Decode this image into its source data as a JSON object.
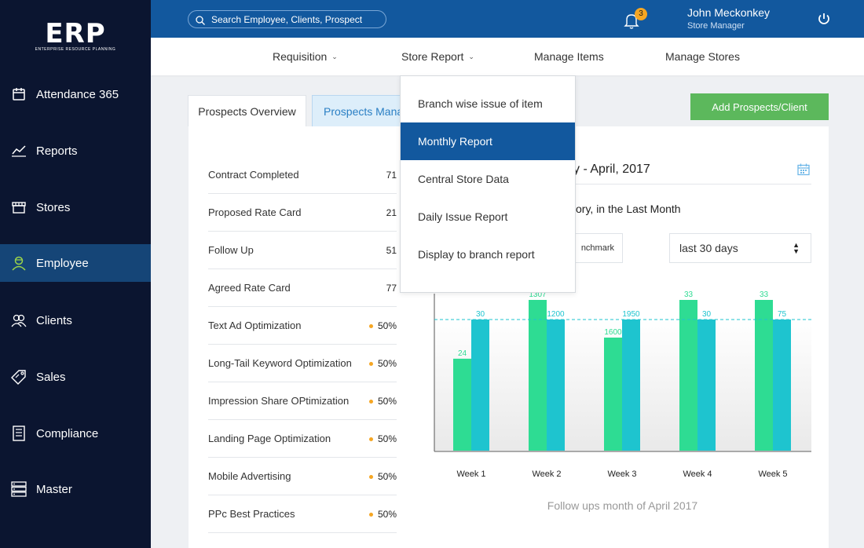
{
  "app": {
    "logo": "ERP",
    "logo_sub": "ENTERPRISE RESOURCE PLANNING"
  },
  "sidebar": {
    "items": [
      {
        "label": "Attendance 365",
        "icon": "calendar-icon"
      },
      {
        "label": "Reports",
        "icon": "trend-icon"
      },
      {
        "label": "Stores",
        "icon": "store-icon"
      },
      {
        "label": "Employee",
        "icon": "user-icon",
        "active": true
      },
      {
        "label": "Clients",
        "icon": "clients-icon"
      },
      {
        "label": "Sales",
        "icon": "tag-icon"
      },
      {
        "label": "Compliance",
        "icon": "document-icon"
      },
      {
        "label": "Master",
        "icon": "server-icon"
      }
    ]
  },
  "header": {
    "search_placeholder": "Search Employee, Clients, Prospect",
    "notifications": "3",
    "user_name": "John Meckonkey",
    "user_role": "Store Manager"
  },
  "menu": {
    "items": [
      {
        "label": "Requisition",
        "has_chevron": true
      },
      {
        "label": "Store Report",
        "has_chevron": true
      },
      {
        "label": "Manage Items",
        "has_chevron": false
      },
      {
        "label": "Manage Stores",
        "has_chevron": false
      }
    ]
  },
  "dropdown": {
    "items": [
      {
        "label": "Branch wise issue of item"
      },
      {
        "label": "Monthly Report",
        "active": true
      },
      {
        "label": "Central Store Data"
      },
      {
        "label": "Daily Issue Report"
      },
      {
        "label": "Display to branch report"
      }
    ]
  },
  "tabs": [
    {
      "label": "Prospects Overview",
      "active": true
    },
    {
      "label": "Prospects Management",
      "active": false
    }
  ],
  "add_button": "Add Prospects/Client",
  "stats": [
    {
      "label": "Contract Completed",
      "value": "71",
      "dot": false
    },
    {
      "label": "Proposed Rate Card",
      "value": "21",
      "dot": false
    },
    {
      "label": "Follow Up",
      "value": "51",
      "dot": false
    },
    {
      "label": "Agreed Rate Card",
      "value": "77",
      "dot": false
    },
    {
      "label": "Text Ad Optimization",
      "value": "50%",
      "dot": true
    },
    {
      "label": "Long-Tail Keyword Optimization",
      "value": "50%",
      "dot": true
    },
    {
      "label": "Impression Share OPtimization",
      "value": "50%",
      "dot": true
    },
    {
      "label": "Landing Page Optimization",
      "value": "50%",
      "dot": true
    },
    {
      "label": "Mobile Advertising",
      "value": "50%",
      "dot": true
    },
    {
      "label": "PPc Best Practices",
      "value": "50%",
      "dot": true
    }
  ],
  "report": {
    "date_fragment": "y - April, 2017",
    "subtitle_fragment": "ory, in the Last Month",
    "benchmark_fragment": "nchmark",
    "range_select": "last 30 days"
  },
  "chart_data": {
    "type": "bar",
    "categories": [
      "Week 1",
      "Week 2",
      "Week 3",
      "Week 4",
      "Week 5"
    ],
    "series": [
      {
        "color": "#2edc93",
        "labels": [
          "24",
          "1307",
          "1600",
          "33",
          "33"
        ],
        "heights": [
          0.61,
          1.0,
          0.75,
          1.0,
          1.0
        ]
      },
      {
        "color": "#1ec4cf",
        "labels": [
          "30",
          "1200",
          "1950",
          "30",
          "75"
        ],
        "heights": [
          0.87,
          0.87,
          0.87,
          0.87,
          0.87
        ]
      }
    ],
    "benchmark": 0.87,
    "caption": "Follow ups month of April 2017"
  },
  "colors": {
    "sidebar": "#0b1530",
    "header": "#12589e",
    "active": "#154577",
    "accent_green": "#5cb85c"
  }
}
